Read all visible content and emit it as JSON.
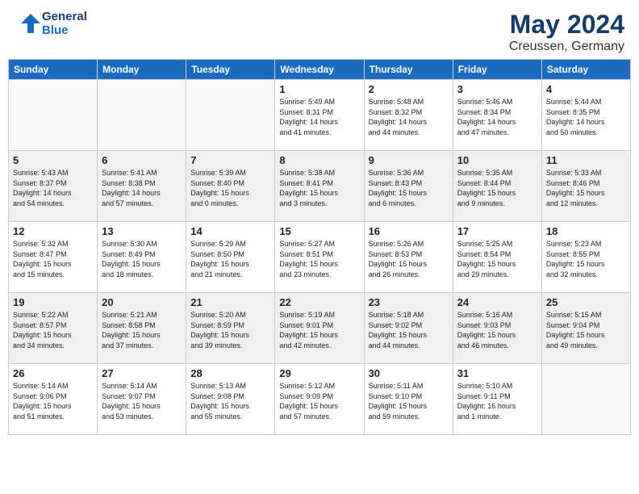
{
  "header": {
    "logo_line1": "General",
    "logo_line2": "Blue",
    "title": "May 2024",
    "subtitle": "Creussen, Germany"
  },
  "days_of_week": [
    "Sunday",
    "Monday",
    "Tuesday",
    "Wednesday",
    "Thursday",
    "Friday",
    "Saturday"
  ],
  "weeks": [
    {
      "days": [
        {
          "num": "",
          "info": ""
        },
        {
          "num": "",
          "info": ""
        },
        {
          "num": "",
          "info": ""
        },
        {
          "num": "1",
          "info": "Sunrise: 5:49 AM\nSunset: 8:31 PM\nDaylight: 14 hours\nand 41 minutes."
        },
        {
          "num": "2",
          "info": "Sunrise: 5:48 AM\nSunset: 8:32 PM\nDaylight: 14 hours\nand 44 minutes."
        },
        {
          "num": "3",
          "info": "Sunrise: 5:46 AM\nSunset: 8:34 PM\nDaylight: 14 hours\nand 47 minutes."
        },
        {
          "num": "4",
          "info": "Sunrise: 5:44 AM\nSunset: 8:35 PM\nDaylight: 14 hours\nand 50 minutes."
        }
      ]
    },
    {
      "days": [
        {
          "num": "5",
          "info": "Sunrise: 5:43 AM\nSunset: 8:37 PM\nDaylight: 14 hours\nand 54 minutes."
        },
        {
          "num": "6",
          "info": "Sunrise: 5:41 AM\nSunset: 8:38 PM\nDaylight: 14 hours\nand 57 minutes."
        },
        {
          "num": "7",
          "info": "Sunrise: 5:39 AM\nSunset: 8:40 PM\nDaylight: 15 hours\nand 0 minutes."
        },
        {
          "num": "8",
          "info": "Sunrise: 5:38 AM\nSunset: 8:41 PM\nDaylight: 15 hours\nand 3 minutes."
        },
        {
          "num": "9",
          "info": "Sunrise: 5:36 AM\nSunset: 8:43 PM\nDaylight: 15 hours\nand 6 minutes."
        },
        {
          "num": "10",
          "info": "Sunrise: 5:35 AM\nSunset: 8:44 PM\nDaylight: 15 hours\nand 9 minutes."
        },
        {
          "num": "11",
          "info": "Sunrise: 5:33 AM\nSunset: 8:46 PM\nDaylight: 15 hours\nand 12 minutes."
        }
      ]
    },
    {
      "days": [
        {
          "num": "12",
          "info": "Sunrise: 5:32 AM\nSunset: 8:47 PM\nDaylight: 15 hours\nand 15 minutes."
        },
        {
          "num": "13",
          "info": "Sunrise: 5:30 AM\nSunset: 8:49 PM\nDaylight: 15 hours\nand 18 minutes."
        },
        {
          "num": "14",
          "info": "Sunrise: 5:29 AM\nSunset: 8:50 PM\nDaylight: 15 hours\nand 21 minutes."
        },
        {
          "num": "15",
          "info": "Sunrise: 5:27 AM\nSunset: 8:51 PM\nDaylight: 15 hours\nand 23 minutes."
        },
        {
          "num": "16",
          "info": "Sunrise: 5:26 AM\nSunset: 8:53 PM\nDaylight: 15 hours\nand 26 minutes."
        },
        {
          "num": "17",
          "info": "Sunrise: 5:25 AM\nSunset: 8:54 PM\nDaylight: 15 hours\nand 29 minutes."
        },
        {
          "num": "18",
          "info": "Sunrise: 5:23 AM\nSunset: 8:55 PM\nDaylight: 15 hours\nand 32 minutes."
        }
      ]
    },
    {
      "days": [
        {
          "num": "19",
          "info": "Sunrise: 5:22 AM\nSunset: 8:57 PM\nDaylight: 15 hours\nand 34 minutes."
        },
        {
          "num": "20",
          "info": "Sunrise: 5:21 AM\nSunset: 8:58 PM\nDaylight: 15 hours\nand 37 minutes."
        },
        {
          "num": "21",
          "info": "Sunrise: 5:20 AM\nSunset: 8:59 PM\nDaylight: 15 hours\nand 39 minutes."
        },
        {
          "num": "22",
          "info": "Sunrise: 5:19 AM\nSunset: 9:01 PM\nDaylight: 15 hours\nand 42 minutes."
        },
        {
          "num": "23",
          "info": "Sunrise: 5:18 AM\nSunset: 9:02 PM\nDaylight: 15 hours\nand 44 minutes."
        },
        {
          "num": "24",
          "info": "Sunrise: 5:16 AM\nSunset: 9:03 PM\nDaylight: 15 hours\nand 46 minutes."
        },
        {
          "num": "25",
          "info": "Sunrise: 5:15 AM\nSunset: 9:04 PM\nDaylight: 15 hours\nand 49 minutes."
        }
      ]
    },
    {
      "days": [
        {
          "num": "26",
          "info": "Sunrise: 5:14 AM\nSunset: 9:06 PM\nDaylight: 15 hours\nand 51 minutes."
        },
        {
          "num": "27",
          "info": "Sunrise: 5:14 AM\nSunset: 9:07 PM\nDaylight: 15 hours\nand 53 minutes."
        },
        {
          "num": "28",
          "info": "Sunrise: 5:13 AM\nSunset: 9:08 PM\nDaylight: 15 hours\nand 55 minutes."
        },
        {
          "num": "29",
          "info": "Sunrise: 5:12 AM\nSunset: 9:09 PM\nDaylight: 15 hours\nand 57 minutes."
        },
        {
          "num": "30",
          "info": "Sunrise: 5:11 AM\nSunset: 9:10 PM\nDaylight: 15 hours\nand 59 minutes."
        },
        {
          "num": "31",
          "info": "Sunrise: 5:10 AM\nSunset: 9:11 PM\nDaylight: 16 hours\nand 1 minute."
        },
        {
          "num": "",
          "info": ""
        }
      ]
    }
  ]
}
